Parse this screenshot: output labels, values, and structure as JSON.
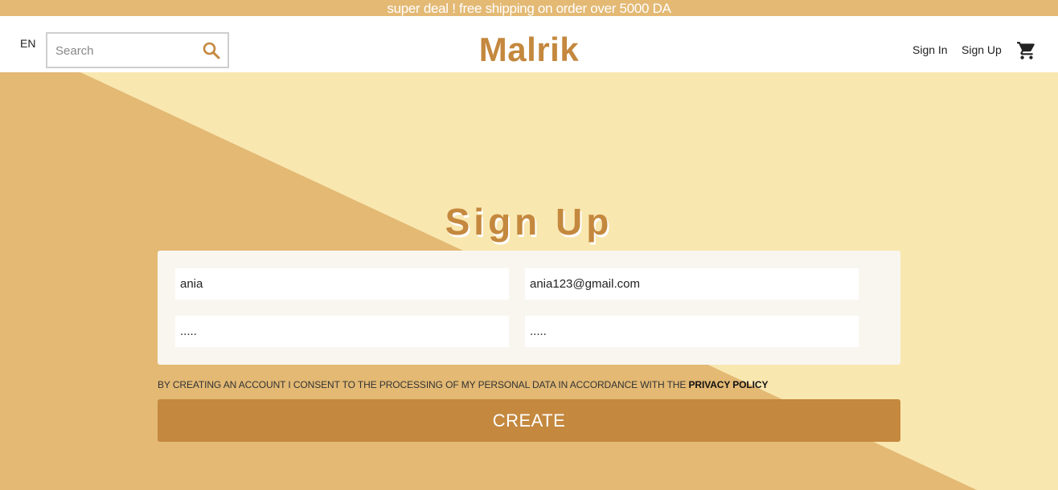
{
  "announcement": {
    "text": "super deal ! free shipping on order over 5000 DA"
  },
  "navbar": {
    "language": "EN",
    "search": {
      "placeholder": "Search",
      "value": ""
    },
    "logo": "Malrik",
    "signin_label": "Sign In",
    "signup_label": "Sign Up",
    "search_icon": "search-icon",
    "cart_icon": "cart-icon"
  },
  "page": {
    "title": "Sign Up"
  },
  "form": {
    "username": {
      "value": "ania"
    },
    "email": {
      "value": "ania123@gmail.com"
    },
    "password": {
      "value": "....."
    },
    "confirm_password": {
      "value": "....."
    }
  },
  "consent": {
    "text": "BY CREATING AN ACCOUNT I CONSENT TO THE PROCESSING OF MY PERSONAL DATA IN ACCORDANCE WITH THE ",
    "policy_label": "PRIVACY POLICY"
  },
  "create_button": {
    "label": "CREATE"
  },
  "colors": {
    "accent": "#c4883e",
    "banner": "#e3b974",
    "background_dark": "#e3b974",
    "background_light": "#f9e7b0",
    "card": "#f9f6f0"
  }
}
